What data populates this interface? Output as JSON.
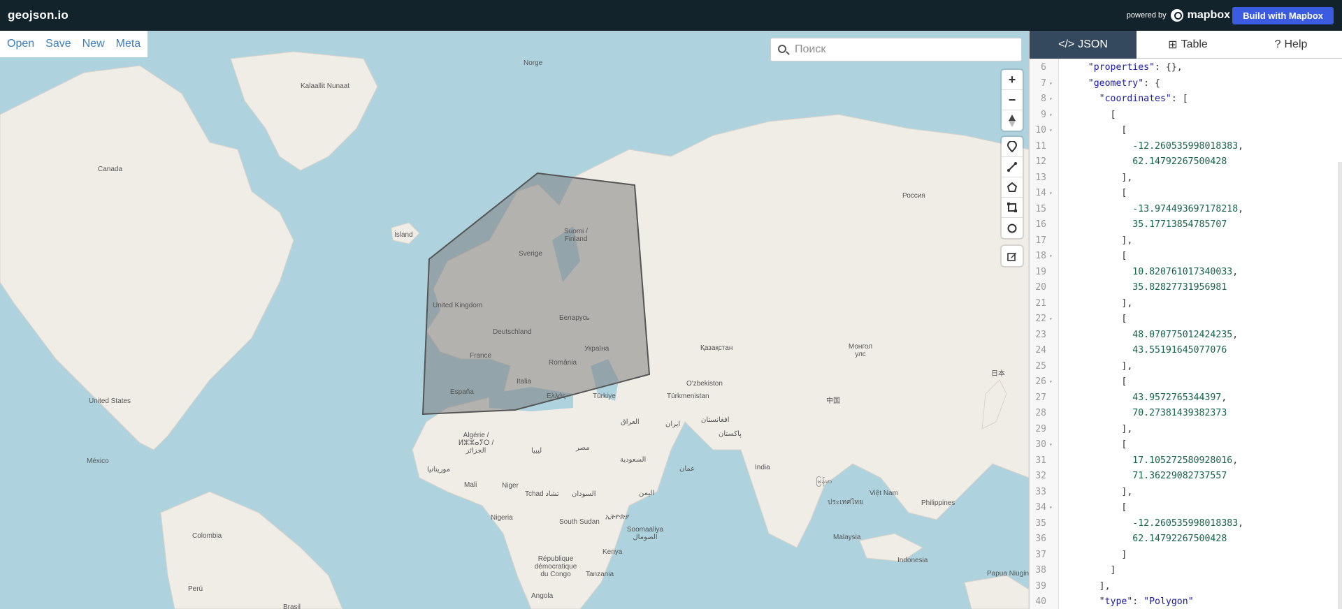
{
  "header": {
    "brand": "geojson.io",
    "powered_by": "powered by",
    "mapbox": "mapbox",
    "build_button": "Build with Mapbox"
  },
  "menu": {
    "items": [
      "Open",
      "Save",
      "New",
      "Meta"
    ]
  },
  "search": {
    "placeholder": "Поиск"
  },
  "map_labels": [
    {
      "text": "Kalaallit Nunaat"
    },
    {
      "text": "Canada"
    },
    {
      "text": "Ísland"
    },
    {
      "text": "Norge"
    },
    {
      "text": "Suomi / Finland"
    },
    {
      "text": "Sverige"
    },
    {
      "text": "United Kingdom"
    },
    {
      "text": "Беларусь"
    },
    {
      "text": "Deutschland"
    },
    {
      "text": "Україна"
    },
    {
      "text": "France"
    },
    {
      "text": "România"
    },
    {
      "text": "Italia"
    },
    {
      "text": "España"
    },
    {
      "text": "Ελλάς"
    },
    {
      "text": "Türkiye"
    },
    {
      "text": "Россия"
    },
    {
      "text": "Қазақстан"
    },
    {
      "text": "Монгол улс"
    },
    {
      "text": "O'zbekiston"
    },
    {
      "text": "Türkmenistan"
    },
    {
      "text": "United States"
    },
    {
      "text": "México"
    },
    {
      "text": "Colombia"
    },
    {
      "text": "Perú"
    },
    {
      "text": "Algérie / ⵍⵣⵣⴰⵢⵔ / الجزائر"
    },
    {
      "text": "ليبيا"
    },
    {
      "text": "مصر"
    },
    {
      "text": "العراق"
    },
    {
      "text": "ایران"
    },
    {
      "text": "افغانستان"
    },
    {
      "text": "پاکستان"
    },
    {
      "text": "السعودية"
    },
    {
      "text": "موريتانيا"
    },
    {
      "text": "Mali"
    },
    {
      "text": "Niger"
    },
    {
      "text": "Tchad تشاد"
    },
    {
      "text": "السودان"
    },
    {
      "text": "اليمن"
    },
    {
      "text": "عمان"
    },
    {
      "text": "India"
    },
    {
      "text": "中国"
    },
    {
      "text": "日本"
    },
    {
      "text": "Nigeria"
    },
    {
      "text": "South Sudan"
    },
    {
      "text": "ኢትዮጵያ"
    },
    {
      "text": "Soomaaliya الصومال"
    },
    {
      "text": "Kenya"
    },
    {
      "text": "République démocratique du Congo"
    },
    {
      "text": "Tanzania"
    },
    {
      "text": "Angola"
    },
    {
      "text": "Brasil"
    },
    {
      "text": "Việt Nam"
    },
    {
      "text": "Philippines"
    },
    {
      "text": "Malaysia"
    },
    {
      "text": "Indonesia"
    },
    {
      "text": "Papua Niugini"
    },
    {
      "text": "မြန်မာ"
    },
    {
      "text": "ประเทศไทย"
    }
  ],
  "tabs": [
    {
      "label": "JSON",
      "icon": "code-icon"
    },
    {
      "label": "Table",
      "icon": "table-icon"
    },
    {
      "label": "Help",
      "icon": "question-icon"
    }
  ],
  "editor": {
    "lines": [
      {
        "n": "6",
        "fold": false,
        "text": "    \"properties\": {},"
      },
      {
        "n": "7",
        "fold": true,
        "text": "    \"geometry\": {"
      },
      {
        "n": "8",
        "fold": true,
        "text": "      \"coordinates\": ["
      },
      {
        "n": "9",
        "fold": true,
        "text": "        ["
      },
      {
        "n": "10",
        "fold": true,
        "text": "          ["
      },
      {
        "n": "11",
        "fold": false,
        "text": "            -12.260535998018383,"
      },
      {
        "n": "12",
        "fold": false,
        "text": "            62.14792267500428"
      },
      {
        "n": "13",
        "fold": false,
        "text": "          ],"
      },
      {
        "n": "14",
        "fold": true,
        "text": "          ["
      },
      {
        "n": "15",
        "fold": false,
        "text": "            -13.974493697178218,"
      },
      {
        "n": "16",
        "fold": false,
        "text": "            35.17713854785707"
      },
      {
        "n": "17",
        "fold": false,
        "text": "          ],"
      },
      {
        "n": "18",
        "fold": true,
        "text": "          ["
      },
      {
        "n": "19",
        "fold": false,
        "text": "            10.820761017340033,"
      },
      {
        "n": "20",
        "fold": false,
        "text": "            35.82827731956981"
      },
      {
        "n": "21",
        "fold": false,
        "text": "          ],"
      },
      {
        "n": "22",
        "fold": true,
        "text": "          ["
      },
      {
        "n": "23",
        "fold": false,
        "text": "            48.070775012424235,"
      },
      {
        "n": "24",
        "fold": false,
        "text": "            43.55191645077076"
      },
      {
        "n": "25",
        "fold": false,
        "text": "          ],"
      },
      {
        "n": "26",
        "fold": true,
        "text": "          ["
      },
      {
        "n": "27",
        "fold": false,
        "text": "            43.9572765344397,"
      },
      {
        "n": "28",
        "fold": false,
        "text": "            70.27381439382373"
      },
      {
        "n": "29",
        "fold": false,
        "text": "          ],"
      },
      {
        "n": "30",
        "fold": true,
        "text": "          ["
      },
      {
        "n": "31",
        "fold": false,
        "text": "            17.105272580928016,"
      },
      {
        "n": "32",
        "fold": false,
        "text": "            71.36229082737557"
      },
      {
        "n": "33",
        "fold": false,
        "text": "          ],"
      },
      {
        "n": "34",
        "fold": true,
        "text": "          ["
      },
      {
        "n": "35",
        "fold": false,
        "text": "            -12.260535998018383,"
      },
      {
        "n": "36",
        "fold": false,
        "text": "            62.14792267500428"
      },
      {
        "n": "37",
        "fold": false,
        "text": "          ]"
      },
      {
        "n": "38",
        "fold": false,
        "text": "        ]"
      },
      {
        "n": "39",
        "fold": false,
        "text": "      ],"
      },
      {
        "n": "40",
        "fold": false,
        "text": "      \"type\": \"Polygon\""
      }
    ]
  },
  "colors": {
    "topbar": "#12232c",
    "accent": "#3b5ce0",
    "water": "#aed3df",
    "land": "#f0ede7",
    "tab_active": "#34495e"
  }
}
